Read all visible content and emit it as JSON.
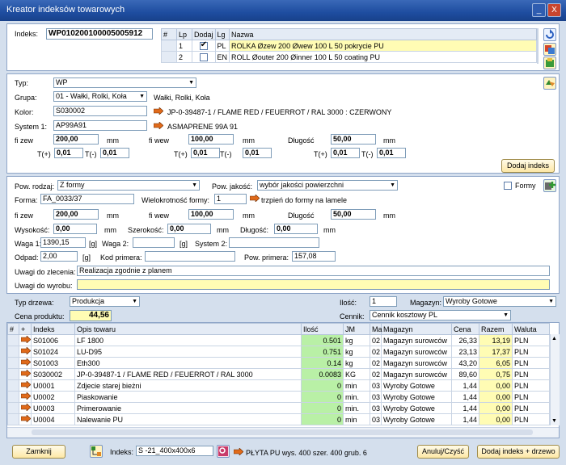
{
  "window": {
    "title": "Kreator indeksów towarowych",
    "minimize": "_",
    "close": "X"
  },
  "index_panel": {
    "label": "Indeks:",
    "value": "WP010200100005005912",
    "table": {
      "headers": [
        "#",
        "Lp",
        "Dodaj",
        "Lg",
        "Nazwa"
      ],
      "rows": [
        {
          "lp": "1",
          "checked": true,
          "lg": "PL",
          "name": "ROLKA Øzew 200 Øwew 100 L 50 pokrycie PU"
        },
        {
          "lp": "2",
          "checked": false,
          "lg": "EN",
          "name": "ROLL Øouter 200 Øinner 100 L 50 coating PU"
        }
      ]
    }
  },
  "spec": {
    "typ_label": "Typ:",
    "typ_value": "WP",
    "grupa_label": "Grupa:",
    "grupa_value": "01 - Wałki, Rolki, Koła",
    "grupa_desc": "Wałki, Rolki, Koła",
    "kolor_label": "Kolor:",
    "kolor_value": "S030002",
    "kolor_desc": "JP-0-39487-1 / FLAME RED / FEUERROT / RAL 3000  :  CZERWONY",
    "system_label": "System 1:",
    "system_value": "AP99A91",
    "system_desc": "ASMAPRENE 99A 91",
    "fizew_label": "fi zew",
    "fizew_value": "200,00",
    "fizew_unit": "mm",
    "fiwew_label": "fi wew",
    "fiwew_value": "100,00",
    "fiwew_unit": "mm",
    "dlugosc_label": "Długość",
    "dlugosc_value": "50,00",
    "dlugosc_unit": "mm",
    "tplus_label": "T(+)",
    "tminus_label": "T(-)",
    "tol_value": "0,01",
    "add_button": "Dodaj indeks"
  },
  "production": {
    "pow_rodzaj_label": "Pow. rodzaj:",
    "pow_rodzaj_value": "Z formy",
    "pow_jakosc_label": "Pow. jakość:",
    "pow_jakosc_value": "wybór jakości powierzchni",
    "formy_label": "Formy",
    "forma_label": "Forma:",
    "forma_value": "FA_0033/37",
    "wielokrotnosc_label": "Wielokrotność formy:",
    "wielokrotnosc_value": "1",
    "wielokrotnosc_desc": "trzpień do formy na lamele",
    "fizew_label": "fi zew",
    "fizew_value": "200,00",
    "fizew_unit": "mm",
    "fiwew_label": "fi wew",
    "fiwew_value": "100,00",
    "fiwew_unit": "mm",
    "dlugosc_label": "Długość",
    "dlugosc_value": "50,00",
    "dlugosc_unit": "mm",
    "wysokosc_label": "Wysokość:",
    "wysokosc_value": "0,00",
    "wysokosc_unit": "mm",
    "szerokosc_label": "Szerokość:",
    "szerokosc_value": "0,00",
    "szerokosc_unit": "mm",
    "dlugosc2_label": "Długość:",
    "dlugosc2_value": "0,00",
    "dlugosc2_unit": "mm",
    "waga1_label": "Waga 1:",
    "waga1_value": "1390,15",
    "waga_unit": "[g]",
    "waga2_label": "Waga 2:",
    "waga2_value": "",
    "system2_label": "System 2:",
    "system2_value": "",
    "odpad_label": "Odpad:",
    "odpad_value": "2,00",
    "odpad_unit": "[g]",
    "kod_label": "Kod primera:",
    "kod_value": "",
    "pow_primera_label": "Pow. primera:",
    "pow_primera_value": "157,08",
    "uwagi_zlec_label": "Uwagi do zlecenia:",
    "uwagi_zlec_value": "Realizacja zgodnie z planem",
    "uwagi_wyr_label": "Uwagi do wyrobu:",
    "uwagi_wyr_value": ""
  },
  "bottom": {
    "typ_drzewa_label": "Typ drzewa:",
    "typ_drzewa_value": "Produkcja",
    "ilosc_label": "Ilość:",
    "ilosc_value": "1",
    "magazyn_label": "Magazyn:",
    "magazyn_value": "Wyroby Gotowe",
    "cena_label": "Cena produktu:",
    "cena_value": "44,56",
    "cennik_label": "Cennik:",
    "cennik_value": "Cennik kosztowy PL"
  },
  "bom": {
    "headers": [
      "#",
      "+",
      "Indeks",
      "Opis towaru",
      "Ilość",
      "JM",
      "Ma",
      "Magazyn",
      "Cena",
      "Razem",
      "Waluta"
    ],
    "rows": [
      {
        "indeks": "S01006",
        "opis": "LF 1800",
        "ilosc": "0.501",
        "jm": "kg",
        "ma": "02",
        "magazyn": "Magazyn surowców",
        "cena": "26,33",
        "razem": "13,19",
        "waluta": "PLN"
      },
      {
        "indeks": "S01024",
        "opis": "LU-D95",
        "ilosc": "0.751",
        "jm": "kg",
        "ma": "02",
        "magazyn": "Magazyn surowców",
        "cena": "23,13",
        "razem": "17,37",
        "waluta": "PLN"
      },
      {
        "indeks": "S01003",
        "opis": "Eth300",
        "ilosc": "0.14",
        "jm": "kg",
        "ma": "02",
        "magazyn": "Magazyn surowców",
        "cena": "43,20",
        "razem": "6,05",
        "waluta": "PLN"
      },
      {
        "indeks": "S030002",
        "opis": "JP-0-39487-1 / FLAME RED / FEUERROT / RAL 3000",
        "ilosc": "0.0083",
        "jm": "KG",
        "ma": "02",
        "magazyn": "Magazyn surowców",
        "cena": "89,60",
        "razem": "0,75",
        "waluta": "PLN"
      },
      {
        "indeks": "U0001",
        "opis": "Zdjecie starej bieżni",
        "ilosc": "0",
        "jm": "min",
        "ma": "03",
        "magazyn": "Wyroby Gotowe",
        "cena": "1,44",
        "razem": "0,00",
        "waluta": "PLN"
      },
      {
        "indeks": "U0002",
        "opis": "Piaskowanie",
        "ilosc": "0",
        "jm": "min.",
        "ma": "03",
        "magazyn": "Wyroby Gotowe",
        "cena": "1,44",
        "razem": "0,00",
        "waluta": "PLN"
      },
      {
        "indeks": "U0003",
        "opis": "Primerowanie",
        "ilosc": "0",
        "jm": "min.",
        "ma": "03",
        "magazyn": "Wyroby Gotowe",
        "cena": "1,44",
        "razem": "0,00",
        "waluta": "PLN"
      },
      {
        "indeks": "U0004",
        "opis": "Nalewanie PU",
        "ilosc": "0",
        "jm": "min",
        "ma": "03",
        "magazyn": "Wyroby Gotowe",
        "cena": "1,44",
        "razem": "0,00",
        "waluta": "PLN"
      }
    ]
  },
  "footer": {
    "close_button": "Zamknij",
    "indeks_label": "Indeks:",
    "indeks_value": "S -21_400x400x6",
    "indeks_desc": "PŁYTA PU wys. 400  szer. 400  grub. 6",
    "cancel_button": "Anuluj/Czyść",
    "add_tree_button": "Dodaj indeks + drzewo"
  },
  "colors": {
    "accent": "#1e4da0",
    "highlight_yellow": "#fffcb4",
    "qty_green": "#b9f0a6",
    "arrow_orange": "#e06a1a"
  }
}
